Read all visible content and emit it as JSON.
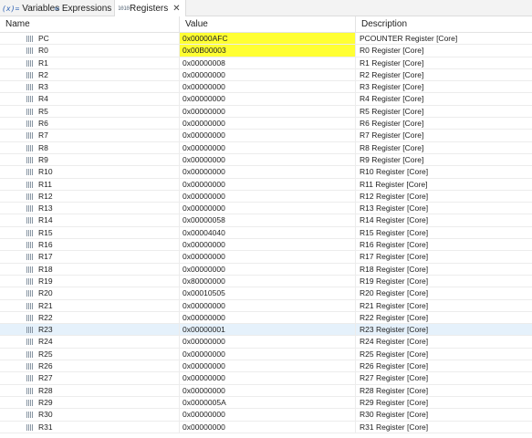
{
  "tabs": [
    {
      "icon": "(x)=",
      "label": "Variables"
    },
    {
      "icon": "∞",
      "label": "Expressions"
    },
    {
      "icon": "1010",
      "label": "Registers"
    }
  ],
  "columns": {
    "name": "Name",
    "value": "Value",
    "description": "Description"
  },
  "rows": [
    {
      "name": "PC",
      "value": "0x00000AFC",
      "description": "PCOUNTER Register [Core]",
      "highlight": true
    },
    {
      "name": "R0",
      "value": "0x00B00003",
      "description": "R0 Register [Core]",
      "highlight": true
    },
    {
      "name": "R1",
      "value": "0x00000008",
      "description": "R1 Register [Core]"
    },
    {
      "name": "R2",
      "value": "0x00000000",
      "description": "R2 Register [Core]"
    },
    {
      "name": "R3",
      "value": "0x00000000",
      "description": "R3 Register [Core]"
    },
    {
      "name": "R4",
      "value": "0x00000000",
      "description": "R4 Register [Core]"
    },
    {
      "name": "R5",
      "value": "0x00000000",
      "description": "R5 Register [Core]"
    },
    {
      "name": "R6",
      "value": "0x00000000",
      "description": "R6 Register [Core]"
    },
    {
      "name": "R7",
      "value": "0x00000000",
      "description": "R7 Register [Core]"
    },
    {
      "name": "R8",
      "value": "0x00000000",
      "description": "R8 Register [Core]"
    },
    {
      "name": "R9",
      "value": "0x00000000",
      "description": "R9 Register [Core]"
    },
    {
      "name": "R10",
      "value": "0x00000000",
      "description": "R10 Register [Core]"
    },
    {
      "name": "R11",
      "value": "0x00000000",
      "description": "R11 Register [Core]"
    },
    {
      "name": "R12",
      "value": "0x00000000",
      "description": "R12 Register [Core]"
    },
    {
      "name": "R13",
      "value": "0x00000000",
      "description": "R13 Register [Core]"
    },
    {
      "name": "R14",
      "value": "0x00000058",
      "description": "R14 Register [Core]"
    },
    {
      "name": "R15",
      "value": "0x00004040",
      "description": "R15 Register [Core]"
    },
    {
      "name": "R16",
      "value": "0x00000000",
      "description": "R16 Register [Core]"
    },
    {
      "name": "R17",
      "value": "0x00000000",
      "description": "R17 Register [Core]"
    },
    {
      "name": "R18",
      "value": "0x00000000",
      "description": "R18 Register [Core]"
    },
    {
      "name": "R19",
      "value": "0x80000000",
      "description": "R19 Register [Core]"
    },
    {
      "name": "R20",
      "value": "0x00010505",
      "description": "R20 Register [Core]"
    },
    {
      "name": "R21",
      "value": "0x00000000",
      "description": "R21 Register [Core]"
    },
    {
      "name": "R22",
      "value": "0x00000000",
      "description": "R22 Register [Core]"
    },
    {
      "name": "R23",
      "value": "0x00000001",
      "description": "R23 Register [Core]",
      "selected": true
    },
    {
      "name": "R24",
      "value": "0x00000000",
      "description": "R24 Register [Core]"
    },
    {
      "name": "R25",
      "value": "0x00000000",
      "description": "R25 Register [Core]"
    },
    {
      "name": "R26",
      "value": "0x00000000",
      "description": "R26 Register [Core]"
    },
    {
      "name": "R27",
      "value": "0x00000000",
      "description": "R27 Register [Core]"
    },
    {
      "name": "R28",
      "value": "0x00000000",
      "description": "R28 Register [Core]"
    },
    {
      "name": "R29",
      "value": "0x0000005A",
      "description": "R29 Register [Core]"
    },
    {
      "name": "R30",
      "value": "0x00000000",
      "description": "R30 Register [Core]"
    },
    {
      "name": "R31",
      "value": "0x00000000",
      "description": "R31 Register [Core]"
    }
  ],
  "colors": {
    "highlight": "#ffff33",
    "selected_row": "#e5f1fb"
  }
}
